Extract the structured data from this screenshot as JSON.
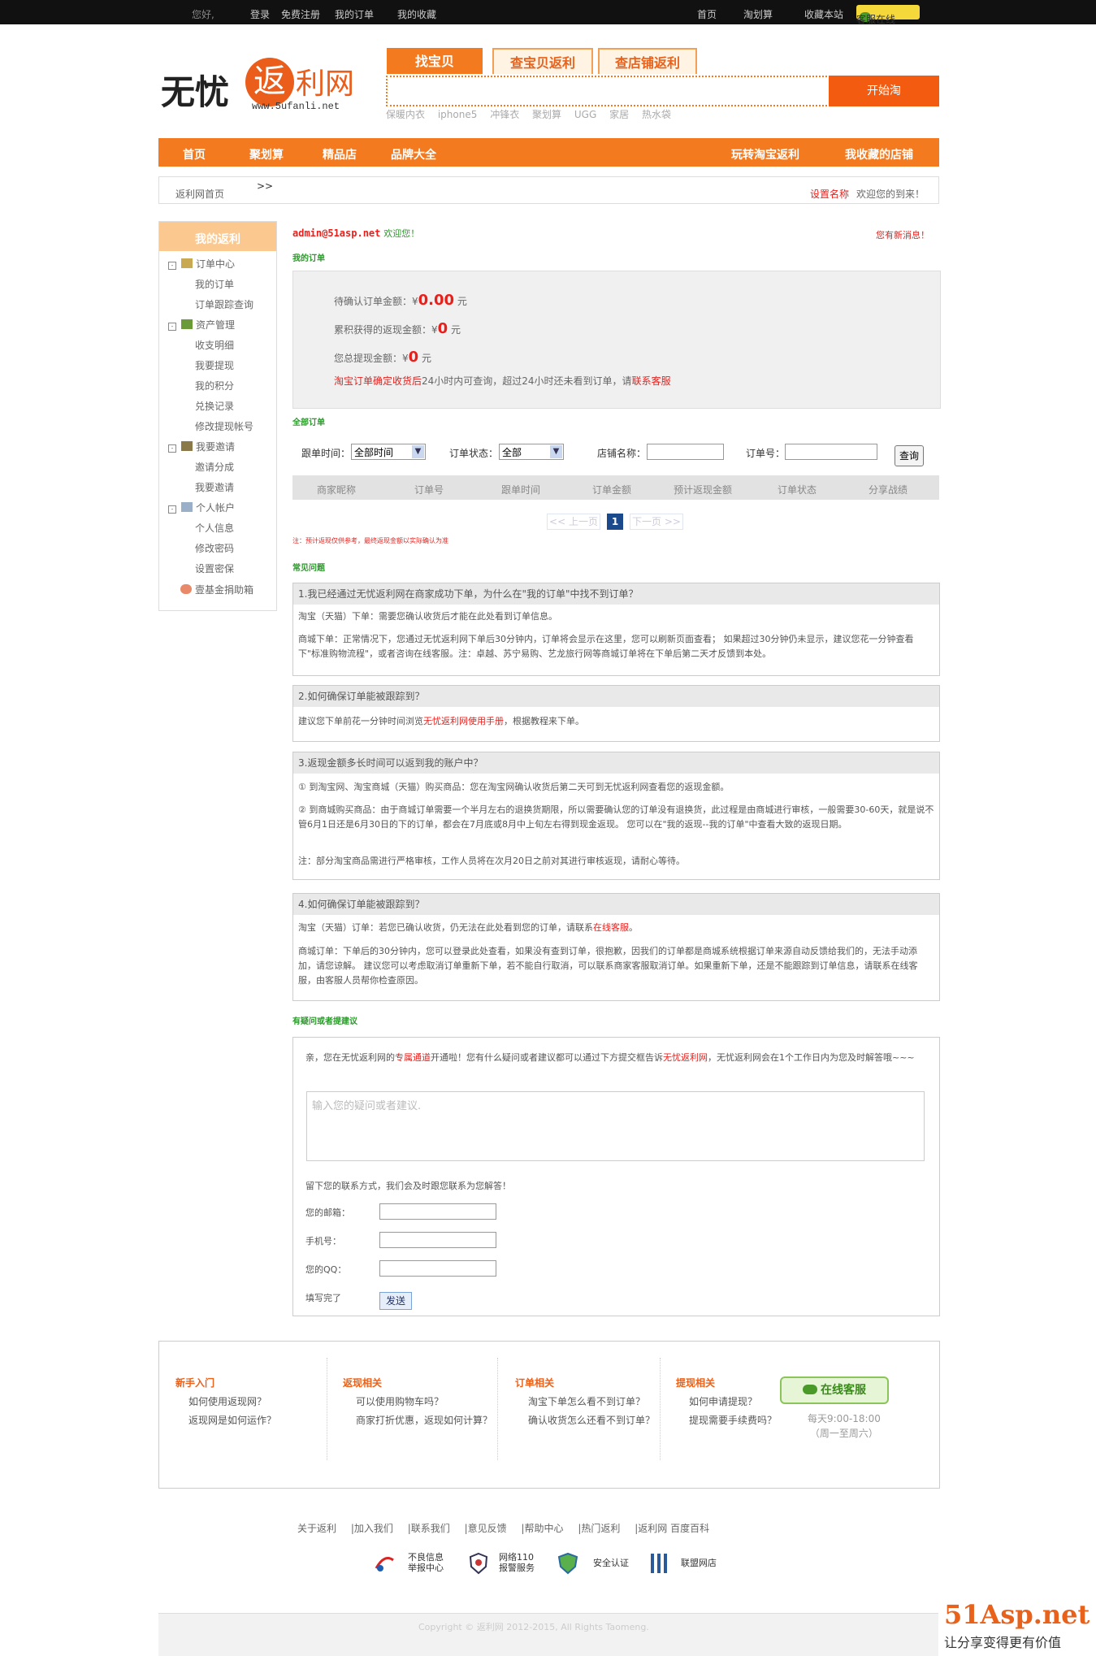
{
  "topbar": {
    "greeting": "您好,",
    "login": "登录",
    "register": "免费注册",
    "my_orders": "我的订单",
    "my_favorites": "我的收藏",
    "home": "首页",
    "taohuasuan": "淘划算",
    "bookmark": "收藏本站",
    "customer_service": "客服在线"
  },
  "logo": {
    "wuyou": "无忧",
    "fan": "返",
    "liwang": "利网",
    "url": "www.5ufanli.net"
  },
  "search": {
    "tabs": [
      "找宝贝",
      "查宝贝返利",
      "查店铺返利"
    ],
    "button": "开始淘",
    "hot_words": [
      "保暖内衣",
      "iphone5",
      "冲锋衣",
      "聚划算",
      "UGG",
      "家居",
      "热水袋"
    ]
  },
  "nav": {
    "items": [
      "首页",
      "聚划算",
      "精品店",
      "品牌大全"
    ],
    "right": [
      "玩转淘宝返利",
      "我收藏的店铺"
    ]
  },
  "breadcrumb": {
    "home": "返利网首页",
    "sep": ">>",
    "set_name": "设置名称",
    "welcome": "欢迎您的到来！"
  },
  "sidebar": {
    "title": "我的返利",
    "groups": [
      {
        "label": "订单中心",
        "items": [
          "我的订单",
          "订单跟踪查询"
        ]
      },
      {
        "label": "资产管理",
        "items": [
          "收支明细",
          "我要提现",
          "我的积分",
          "兑换记录",
          "修改提现帐号"
        ]
      },
      {
        "label": "我要邀请",
        "items": [
          "邀请分成",
          "我要邀请"
        ]
      },
      {
        "label": "个人帐户",
        "items": [
          "个人信息",
          "修改密码",
          "设置密保"
        ]
      }
    ],
    "charity": "壹基金捐助箱"
  },
  "user": {
    "email": "admin@51asp.net",
    "welcome": "欢迎您！",
    "new_msg": "您有新消息！"
  },
  "my_orders": {
    "heading": "我的订单",
    "pending_label": "待确认订单金额：",
    "pending_currency": "¥",
    "pending_value": "0.00",
    "pending_unit": "元",
    "earned_label": "累积获得的返现金额：",
    "earned_currency": "¥",
    "earned_value": "0",
    "earned_unit": "元",
    "withdrawn_label": "您总提现金额：",
    "withdrawn_currency": "¥",
    "withdrawn_value": "0",
    "withdrawn_unit": "元",
    "note_red": "淘宝订单确定收货后",
    "note_mid": "24小时内可查询，超过24小时还未看到订单，请",
    "note_link": "联系客服"
  },
  "all_orders": {
    "heading": "全部订单",
    "filter": {
      "time_label": "跟单时间：",
      "time_value": "全部时间",
      "status_label": "订单状态：",
      "status_value": "全部",
      "shop_label": "店铺名称：",
      "order_label": "订单号：",
      "query": "查询"
    },
    "columns": [
      "商家昵称",
      "订单号",
      "跟单时间",
      "订单金额",
      "预计返现金额",
      "订单状态",
      "分享战绩"
    ],
    "pager": {
      "prev": "<< 上一页",
      "current": "1",
      "next": "下一页 >>"
    },
    "note": "注：预计返现仅供参考，最终返现金额以实际确认为准"
  },
  "faq": {
    "heading": "常见问题",
    "q1": {
      "question": "1.我已经通过无忧返利网在商家成功下单，为什么在\"我的订单\"中找不到订单？",
      "a1": "淘宝（天猫）下单：需要您确认收货后才能在此处看到订单信息。",
      "a2": "商城下单：正常情况下，您通过无忧返利网下单后30分钟内，订单将会显示在这里，您可以刷新页面查看； 如果超过30分钟仍未显示，建议您花一分钟查看下\"标准购物流程\"，或者咨询在线客服。注：卓越、苏宁易购、艺龙旅行网等商城订单将在下单后第二天才反馈到本处。"
    },
    "q2": {
      "question": "2.如何确保订单能被跟踪到？",
      "a_pre": "建议您下单前花一分钟时间浏览",
      "a_link": "无忧返利网使用手册",
      "a_post": "，根据教程来下单。"
    },
    "q3": {
      "question": "3.返现金额多长时间可以返到我的账户中？",
      "a1": "① 到淘宝网、淘宝商城（天猫）购买商品：您在淘宝网确认收货后第二天可到无忧返利网查看您的返现金额。",
      "a2": "② 到商城购买商品：由于商城订单需要一个半月左右的退换货期限，所以需要确认您的订单没有退换货，此过程是由商城进行审核，一般需要30-60天，就是说不管6月1日还是6月30日的下的订单，都会在7月底或8月中上旬左右得到现金返现。 您可以在\"我的返现--我的订单\"中查看大致的返现日期。",
      "a3": "注：部分淘宝商品需进行严格审核，工作人员将在次月20日之前对其进行审核返现，请耐心等待。"
    },
    "q4": {
      "question": "4.如何确保订单能被跟踪到？",
      "a1_pre": "淘宝（天猫）订单：若您已确认收货，仍无法在此处看到您的订单，请联系",
      "a1_link": "在线客服",
      "a1_post": "。",
      "a2": "商城订单：下单后的30分钟内，您可以登录此处查看，如果没有查到订单，很抱歉，因我们的订单都是商城系统根据订单来源自动反馈给我们的，无法手动添加，请您谅解。 建议您可以考虑取消订单重新下单，若不能自行取消，可以联系商家客服取消订单。如果重新下单，还是不能跟踪到订单信息，请联系在线客服，由客服人员帮你检查原因。"
    }
  },
  "feedback": {
    "heading": "有疑问或者提建议",
    "intro_pre": "亲，您在无忧返利网的",
    "intro_red1": "专属通道",
    "intro_mid": "开通啦！您有什么疑问或者建议都可以通过下方提交框告诉",
    "intro_red2": "无忧返利网",
    "intro_post": "，无忧返利网会在1个工作日内为您及时解答哦~~~",
    "placeholder": "输入您的疑问或者建议.",
    "contact_hint": "留下您的联系方式，我们会及时跟您联系为您解答！",
    "email_label": "您的邮箱：",
    "phone_label": "手机号：",
    "qq_label": "您的QQ：",
    "done_label": "填写完了",
    "send": "发送"
  },
  "footer_help": {
    "cols": [
      {
        "title": "新手入门",
        "links": [
          "如何使用返现网？",
          "返现网是如何运作？"
        ]
      },
      {
        "title": "返现相关",
        "links": [
          "可以使用购物车吗？",
          "商家打折优惠，返现如何计算？"
        ]
      },
      {
        "title": "订单相关",
        "links": [
          "淘宝下单怎么看不到订单？",
          "确认收货怎么还看不到订单？"
        ]
      },
      {
        "title": "提现相关",
        "links": [
          "如何申请提现？",
          "提现需要手续费吗？"
        ]
      }
    ],
    "online": "在线客服",
    "hours": "每天9:00-18:00",
    "days": "（周一至周六）"
  },
  "footer_links": [
    "关于返利",
    "|加入我们",
    "|联系我们",
    "|意见反馈",
    "|帮助中心",
    "|热门返利",
    "|返利网 百度百科"
  ],
  "badges": [
    {
      "l1": "不良信息",
      "l2": "举报中心"
    },
    {
      "l1": "网络110",
      "l2": "报警服务"
    },
    {
      "l1": "安全认证",
      "l2": ""
    },
    {
      "l1": "联盟网店",
      "l2": ""
    }
  ],
  "copyright": "Copyright © 返利网 2012-2015, All Rights Taomeng.",
  "watermark": {
    "brand": "51Asp.net",
    "slogan": "让分享变得更有价值"
  },
  "colors": {
    "orange": "#f47a20",
    "red": "#e8201c",
    "green": "#2a9a2a"
  }
}
